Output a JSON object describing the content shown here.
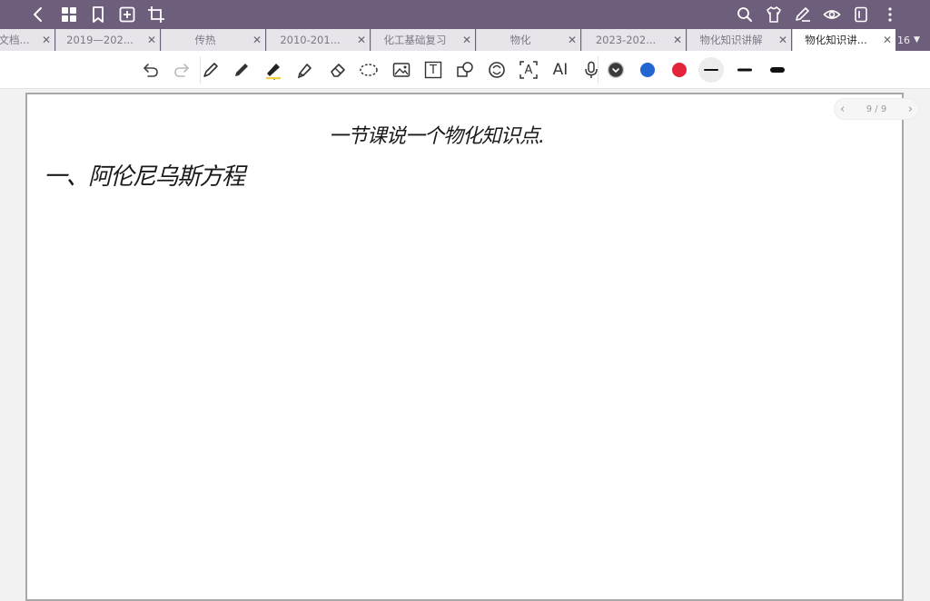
{
  "topbar": {
    "left_icons": [
      "back-icon",
      "grid-icon",
      "bookmark-icon",
      "add-page-icon",
      "crop-icon"
    ],
    "right_icons": [
      "search-icon",
      "shirt-icon",
      "pen-edit-icon",
      "eye-icon",
      "notebook-icon",
      "more-icon"
    ]
  },
  "tabs": [
    {
      "label": "文档...",
      "active": false
    },
    {
      "label": "2019—202...",
      "active": false
    },
    {
      "label": "传热",
      "active": false
    },
    {
      "label": "2010-201...",
      "active": false
    },
    {
      "label": "化工基础复习",
      "active": false
    },
    {
      "label": "物化",
      "active": false
    },
    {
      "label": "2023-202...",
      "active": false
    },
    {
      "label": "物化知识讲解",
      "active": false
    },
    {
      "label": "物化知识讲...",
      "active": true
    }
  ],
  "tab_count": "16",
  "tab_count_icon": "dropdown-triangle-icon",
  "toolbar": {
    "ai_label": "AI",
    "text_tool_glyph": "T",
    "ocr_tool_glyph": "A",
    "colors": {
      "dark": "#3a3a3a",
      "blue": "#2366d1",
      "red": "#e3243b"
    }
  },
  "page_nav": {
    "indicator": "9 / 9"
  },
  "note": {
    "title": "一节课说一个物化知识点.",
    "heading": "一、阿伦尼乌斯方程"
  }
}
